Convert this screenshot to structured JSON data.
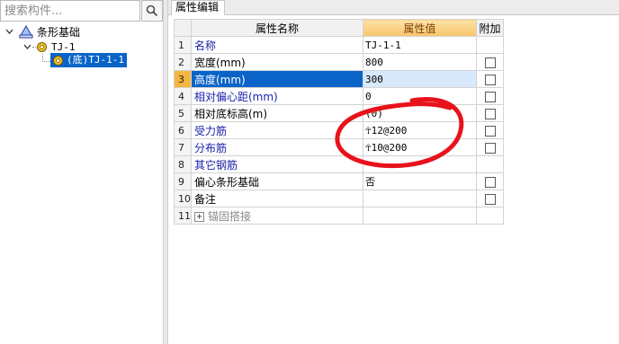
{
  "search": {
    "placeholder": "搜索构件..."
  },
  "tree": {
    "root": {
      "label": "条形基础"
    },
    "node": {
      "label": "TJ-1"
    },
    "leaf": {
      "label": "(底)TJ-1-1"
    }
  },
  "tabs": [
    {
      "label": "属性编辑"
    }
  ],
  "grid": {
    "headers": {
      "index": "",
      "name": "属性名称",
      "value": "属性值",
      "extra": "附加"
    },
    "rows": [
      {
        "index": "1",
        "name": "名称",
        "value": "TJ-1-1"
      },
      {
        "index": "2",
        "name": "宽度(mm)",
        "value": "800"
      },
      {
        "index": "3",
        "name": "高度(mm)",
        "value": "300"
      },
      {
        "index": "4",
        "name": "相对偏心距(mm)",
        "value": "0"
      },
      {
        "index": "5",
        "name": "相对底标高(m)",
        "value": "(0)"
      },
      {
        "index": "6",
        "name": "受力筋",
        "value": "☥12@200"
      },
      {
        "index": "7",
        "name": "分布筋",
        "value": "☥10@200"
      },
      {
        "index": "8",
        "name": "其它钢筋",
        "value": ""
      },
      {
        "index": "9",
        "name": "偏心条形基础",
        "value": "否"
      },
      {
        "index": "10",
        "name": "备注",
        "value": ""
      },
      {
        "index": "11",
        "name": "锚固搭接",
        "value": ""
      }
    ]
  },
  "colors": {
    "selection": "#0a64c8",
    "header_value": "#f7c56b",
    "blue_text": "#1a21a8",
    "annotation": "#e8121b"
  }
}
